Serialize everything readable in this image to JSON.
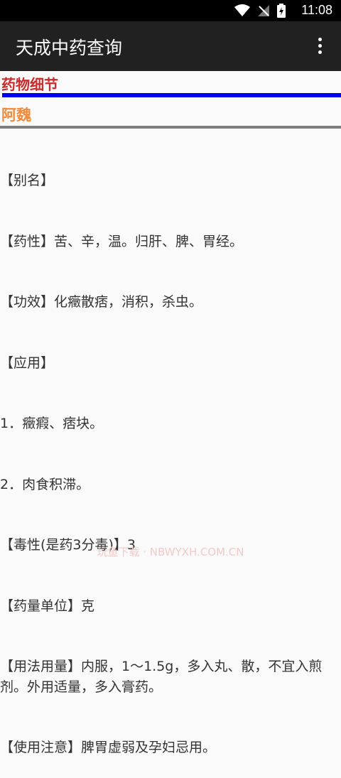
{
  "status_bar": {
    "time": "11:08"
  },
  "app_bar": {
    "title": "天成中药查询",
    "menu_icon": "overflow-menu-icon"
  },
  "page": {
    "section_title": "药物细节",
    "herb_name": "阿魏",
    "details": [
      "【别名】",
      "【药性】苦、辛，温。归肝、脾、胃经。",
      "【功效】化癥散痞，消积，杀虫。",
      "【应用】",
      "1．癥瘕、痞块。",
      "2．肉食积滞。",
      "【毒性(是药3分毒)】3",
      "【药量单位】克",
      "【用法用量】内服，1～1.5g，多入丸、散，不宜入煎剂。外用适量，多入膏药。",
      "【使用注意】脾胃虚弱及孕妇忌用。"
    ]
  },
  "watermark": "玩鱼下载 · NBWYXH.COM.CN",
  "colors": {
    "section_title": "#cc2a2a",
    "herb_name": "#f08a3c",
    "divider_blue": "#0000ee",
    "divider_gray": "#7f7f7f",
    "app_bar": "#212121"
  }
}
